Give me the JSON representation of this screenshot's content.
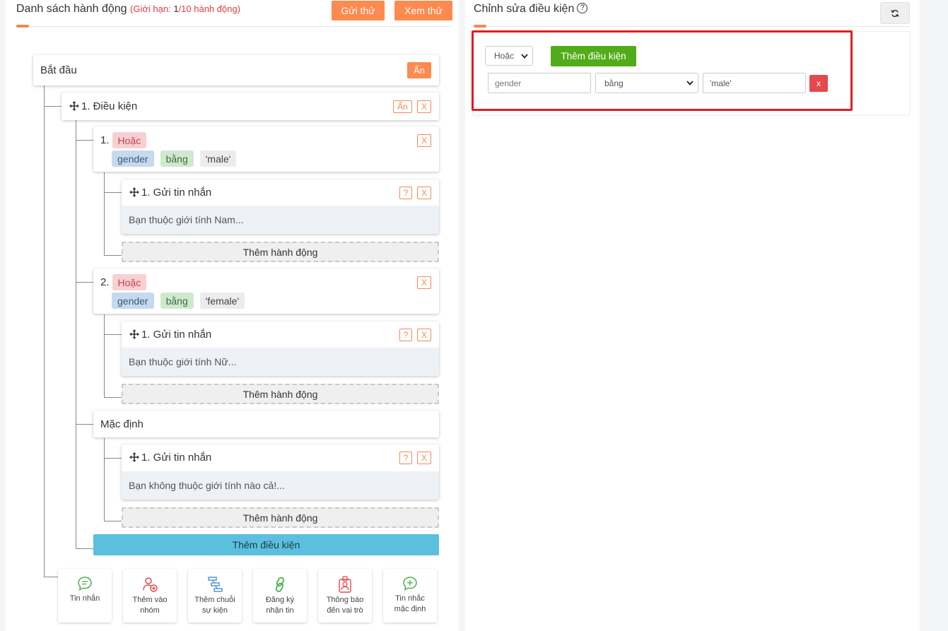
{
  "left": {
    "title": "Danh sách hành động",
    "limit_prefix": "Giới hạn: ",
    "limit_count": "1",
    "limit_suffix": "/10 hành động",
    "send_test_label": "Gửi thử",
    "preview_label": "Xem thử"
  },
  "tree": {
    "start_label": "Bắt đầu",
    "hide_label": "Ẩn",
    "condition_title": "1. Điều kiện",
    "close_label": "X",
    "help_label": "?",
    "branches": [
      {
        "index": "1.",
        "op": "Hoặc",
        "field": "gender",
        "cmp": "bằng",
        "value": "'male'",
        "action_title": "1. Gửi tin nhắn",
        "action_text": "Bạn thuộc giới tính Nam..."
      },
      {
        "index": "2.",
        "op": "Hoặc",
        "field": "gender",
        "cmp": "bằng",
        "value": "'female'",
        "action_title": "1. Gửi tin nhắn",
        "action_text": "Bạn thuộc giới tính Nữ..."
      }
    ],
    "default_label": "Mặc định",
    "default_action_title": "1. Gửi tin nhắn",
    "default_action_text": "Bạn không thuộc giới tính nào cả!...",
    "add_action_label": "Thêm hành động",
    "add_condition_label": "Thêm điều kiện"
  },
  "tools": [
    {
      "l1": "Tin nhắn",
      "l2": "",
      "icon": "message-icon"
    },
    {
      "l1": "Thêm vào",
      "l2": "nhóm",
      "icon": "add-user-icon"
    },
    {
      "l1": "Thêm chuỗi",
      "l2": "sự kiện",
      "icon": "sequence-icon"
    },
    {
      "l1": "Đăng ký",
      "l2": "nhận tin",
      "icon": "link-icon"
    },
    {
      "l1": "Thông báo",
      "l2": "đến vai trò",
      "icon": "badge-icon"
    },
    {
      "l1": "Tin nhắc",
      "l2": "mặc định",
      "icon": "message-plus-icon"
    }
  ],
  "right": {
    "title": "Chỉnh sửa điều kiện",
    "help_symbol": "?",
    "logic_select": "Hoặc",
    "add_condition_label": "Thêm điều kiện",
    "field_value": "gender",
    "operator_select": "bằng",
    "value_input": "'male'",
    "remove_label": "x"
  },
  "colors": {
    "orange": "#fd8a4e",
    "green": "#52ac1a",
    "blue": "#5bc0de",
    "danger": "#e5484d",
    "highlight": "#e31b23"
  }
}
